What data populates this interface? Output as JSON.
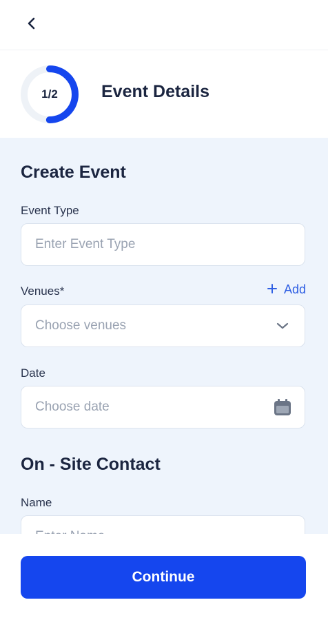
{
  "header": {
    "back_icon": "chevron-left-icon"
  },
  "step": {
    "progress_text": "1/2",
    "progress_fraction": 0.5,
    "title": "Event Details"
  },
  "form": {
    "section_title": "Create Event",
    "event_type": {
      "label": "Event Type",
      "placeholder": "Enter Event Type",
      "value": ""
    },
    "venues": {
      "label": "Venues*",
      "placeholder": "Choose venues",
      "add_label": "Add",
      "add_icon": "plus-icon",
      "dropdown_icon": "chevron-down-icon"
    },
    "date": {
      "label": "Date",
      "placeholder": "Choose date",
      "icon": "calendar-icon"
    },
    "contact_section_title": "On - Site Contact",
    "name": {
      "label": "Name",
      "placeholder": "Enter Name",
      "value": ""
    }
  },
  "footer": {
    "continue_label": "Continue"
  },
  "colors": {
    "accent": "#1546ee",
    "link": "#2f5fe3",
    "form_background": "#eef4fc",
    "text_primary": "#1b2540",
    "placeholder": "#9aa3b2"
  }
}
